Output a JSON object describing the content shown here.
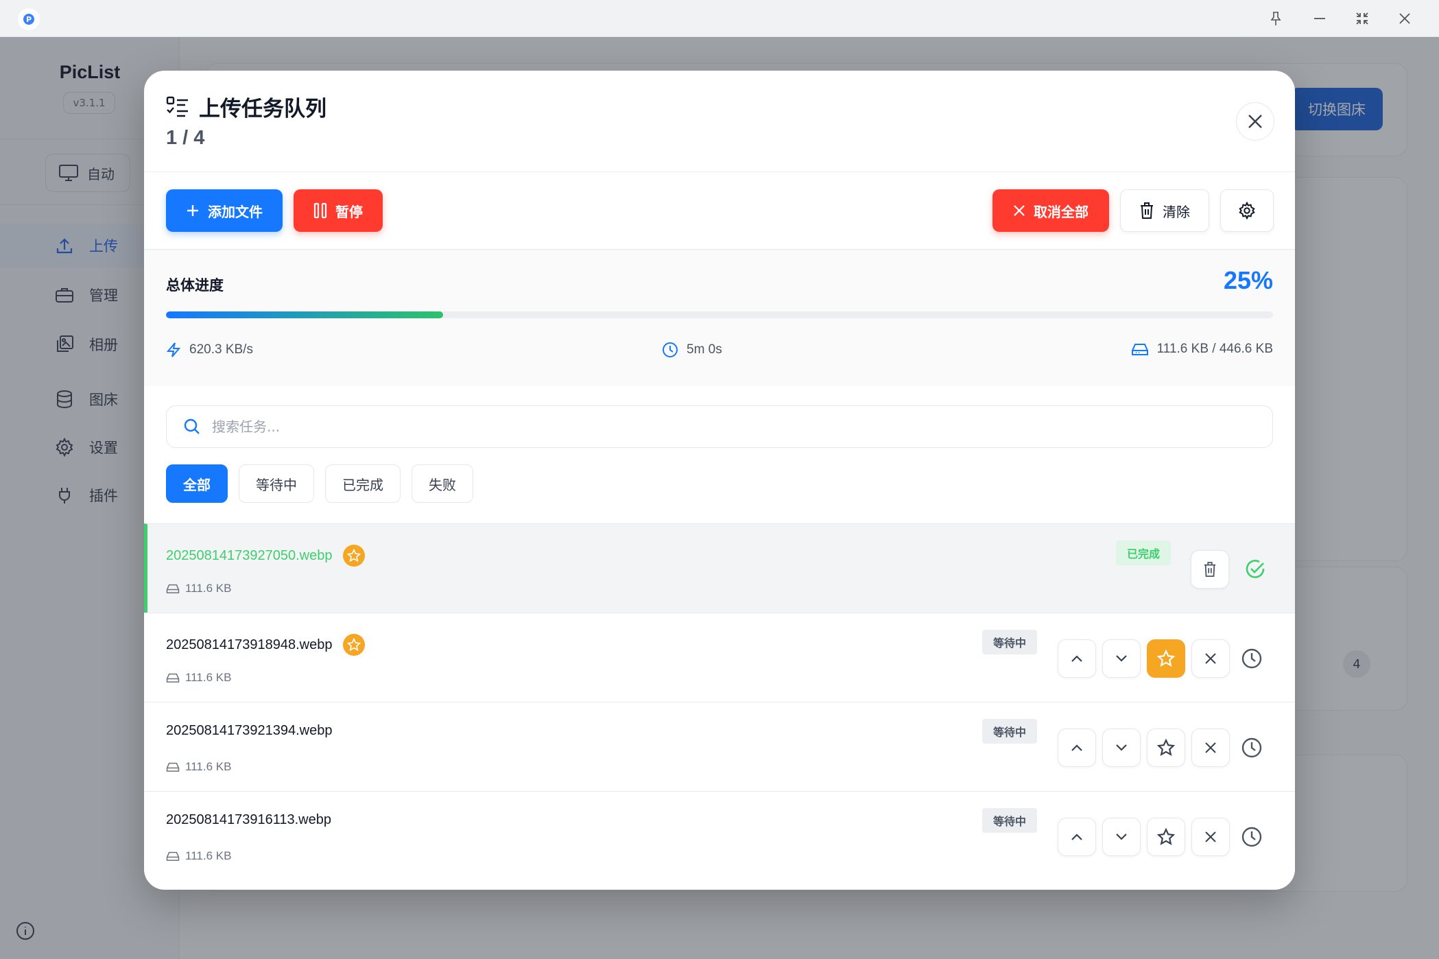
{
  "app": {
    "name": "PicList",
    "version": "v3.1.1",
    "mode_label": "自动",
    "nav": [
      {
        "label": "上传",
        "icon": "upload-icon",
        "active": true
      },
      {
        "label": "管理",
        "icon": "briefcase-icon",
        "active": false
      },
      {
        "label": "相册",
        "icon": "gallery-icon",
        "active": false
      },
      {
        "label": "图床",
        "icon": "database-icon",
        "active": false
      },
      {
        "label": "设置",
        "icon": "gear-icon",
        "active": false
      },
      {
        "label": "插件",
        "icon": "plug-icon",
        "active": false
      }
    ],
    "switch_label": "切换图床",
    "bg_badge": "4"
  },
  "modal": {
    "title": "上传任务队列",
    "count": "1 / 4",
    "toolbar": {
      "add_label": "添加文件",
      "pause_label": "暂停",
      "cancel_all_label": "取消全部",
      "clear_label": "清除"
    },
    "progress": {
      "label": "总体进度",
      "percent_text": "25%",
      "percent": 25,
      "speed": "620.3 KB/s",
      "eta": "5m 0s",
      "size": "111.6 KB / 446.6 KB"
    },
    "search": {
      "placeholder": "搜索任务..."
    },
    "filters": [
      {
        "label": "全部",
        "active": true
      },
      {
        "label": "等待中",
        "active": false
      },
      {
        "label": "已完成",
        "active": false
      },
      {
        "label": "失败",
        "active": false
      }
    ],
    "tasks": [
      {
        "name": "20250814173927050.webp",
        "size": "111.6 KB",
        "status": "已完成",
        "favorite": true
      },
      {
        "name": "20250814173918948.webp",
        "size": "111.6 KB",
        "status": "等待中",
        "favorite": true
      },
      {
        "name": "20250814173921394.webp",
        "size": "111.6 KB",
        "status": "等待中",
        "favorite": false
      },
      {
        "name": "20250814173916113.webp",
        "size": "111.6 KB",
        "status": "等待中",
        "favorite": false
      }
    ]
  },
  "colors": {
    "primary": "#1677ff",
    "danger": "#ff3b30",
    "success": "#3ecf6d",
    "favorite": "#f5a623"
  }
}
